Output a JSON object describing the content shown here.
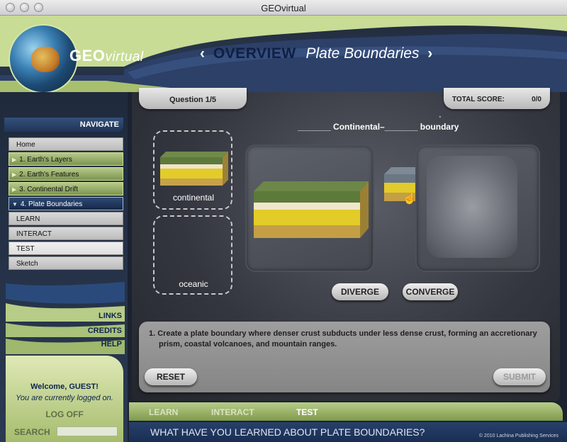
{
  "window": {
    "title": "GEOvirtual"
  },
  "header": {
    "logo_geo": "GEO",
    "logo_virtual": "virtual",
    "left_arrow": "‹",
    "right_arrow": "›",
    "section": "OVERVIEW",
    "topic": "Plate Boundaries"
  },
  "sidebar": {
    "navigate_label": "NAVIGATE",
    "items": [
      {
        "label": "Home"
      },
      {
        "label": "1. Earth's Layers"
      },
      {
        "label": "2. Earth's Features"
      },
      {
        "label": "3. Continental Drift"
      },
      {
        "label": "4. Plate Boundaries"
      },
      {
        "label": "LEARN"
      },
      {
        "label": "INTERACT"
      },
      {
        "label": "TEST"
      },
      {
        "label": "Sketch"
      }
    ],
    "links": "LINKS",
    "credits": "CREDITS",
    "help": "HELP",
    "welcome": "Welcome, GUEST!",
    "logged_on": "You are currently logged on.",
    "log_off": "LOG OFF",
    "search_label": "SEARCH",
    "search_value": ""
  },
  "quiz": {
    "question_counter": "Question 1/5",
    "score_label": "TOTAL SCORE:",
    "score_value": "0/0",
    "boundary_prompt": "_______ Continental–_______ boundary",
    "piece_continental": "continental",
    "piece_oceanic": "oceanic",
    "diverge": "DIVERGE",
    "converge": "CONVERGE",
    "instruction_line1": "1.  Create a plate boundary where denser crust subducts under less dense crust, forming an accretionary",
    "instruction_line2": "prism, coastal volcanoes, and mountain ranges.",
    "reset": "RESET",
    "submit": "SUBMIT"
  },
  "bottom_nav": {
    "tabs": [
      {
        "label": "LEARN"
      },
      {
        "label": "INTERACT"
      },
      {
        "label": "TEST"
      }
    ],
    "question": "WHAT HAVE YOU LEARNED ABOUT PLATE BOUNDARIES?",
    "copyright": "© 2010 Lachina Publishing Services"
  },
  "colors": {
    "accent_green": "#a6bc6d",
    "navy": "#1a2e52",
    "active_nav": "#2e4a74"
  }
}
